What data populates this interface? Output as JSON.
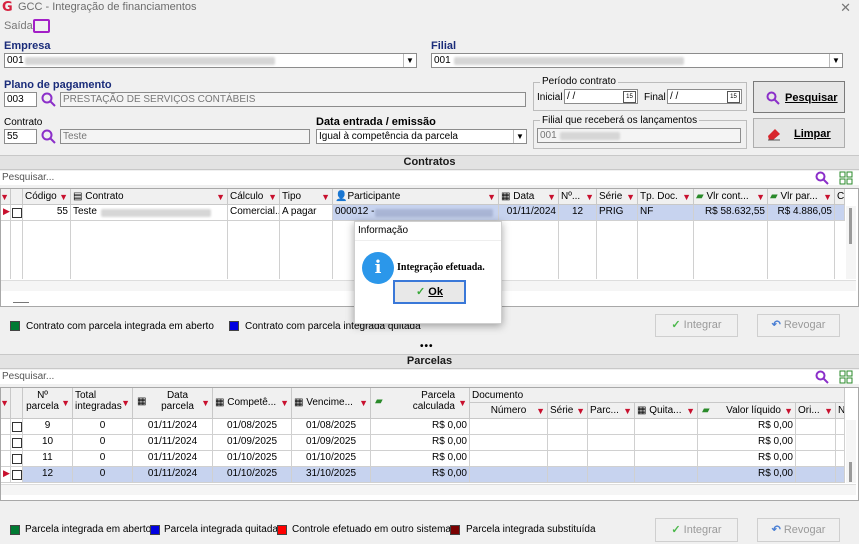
{
  "window": {
    "title": "GCC - Integração de financiamentos",
    "close": "✕",
    "logo": "G"
  },
  "menu": {
    "saida": "Saída"
  },
  "empresa": {
    "label": "Empresa",
    "value": "001"
  },
  "filial": {
    "label": "Filial",
    "value": "001"
  },
  "plano": {
    "label": "Plano de pagamento",
    "code": "003",
    "desc": "PRESTAÇÃO DE SERVIÇOS CONTÁBEIS"
  },
  "periodo": {
    "label": "Período contrato",
    "inicial_label": "Inicial",
    "inicial_value": "/ /",
    "final_label": "Final",
    "final_value": "/ /"
  },
  "contrato": {
    "label": "Contrato",
    "code": "55",
    "desc": "Teste"
  },
  "data_entrada": {
    "label": "Data entrada / emissão",
    "value": "Igual à competência da parcela"
  },
  "filial_lanc": {
    "label": "Filial que receberá os lançamentos",
    "value": "001"
  },
  "buttons": {
    "pesquisar": "Pesquisar",
    "limpar": "Limpar",
    "integrar": "Integrar",
    "revogar": "Revogar"
  },
  "contratos": {
    "section_title": "Contratos",
    "search_placeholder": "Pesquisar...",
    "columns": [
      "Código",
      "Contrato",
      "Cálculo",
      "Tipo",
      "Participante",
      "Data",
      "Nº...",
      "Série",
      "Tp. Doc.",
      "Vlr cont...",
      "Vlr par...",
      "C"
    ],
    "rows": [
      {
        "codigo": "55",
        "contrato": "Teste",
        "calculo": "Comercial...",
        "tipo": "A pagar",
        "participante": "000012 -",
        "data": "01/11/2024",
        "numero": "12",
        "serie": "PRIG",
        "tpdoc": "NF",
        "vlr_cont": "R$ 58.632,55",
        "vlr_par": "R$ 4.886,05"
      }
    ],
    "legend": [
      "Contrato com parcela integrada em aberto",
      "Contrato com parcela integrada quitada"
    ]
  },
  "parcelas": {
    "section_title": "Parcelas",
    "search_placeholder": "Pesquisar...",
    "columns": {
      "numero_parcela": "Nº parcela",
      "total_integradas": "Total integradas",
      "data_parcela": "Data parcela",
      "competencia": "Competê...",
      "vencimento": "Vencime...",
      "parcela_calculada": "Parcela calculada",
      "documento": "Documento",
      "doc_numero": "Número",
      "doc_serie": "Série",
      "doc_parc": "Parc...",
      "doc_quita": "Quita...",
      "valor_liquido": "Valor líquido",
      "ori": "Ori...",
      "n": "N"
    },
    "rows": [
      {
        "num": "9",
        "total": "0",
        "data": "01/11/2024",
        "comp": "01/08/2025",
        "venc": "01/08/2025",
        "calc": "R$ 0,00",
        "liq": "R$ 0,00"
      },
      {
        "num": "10",
        "total": "0",
        "data": "01/11/2024",
        "comp": "01/09/2025",
        "venc": "01/09/2025",
        "calc": "R$ 0,00",
        "liq": "R$ 0,00"
      },
      {
        "num": "11",
        "total": "0",
        "data": "01/11/2024",
        "comp": "01/10/2025",
        "venc": "01/10/2025",
        "calc": "R$ 0,00",
        "liq": "R$ 0,00"
      },
      {
        "num": "12",
        "total": "0",
        "data": "01/11/2024",
        "comp": "01/10/2025",
        "venc": "31/10/2025",
        "calc": "R$ 0,00",
        "liq": "R$ 0,00"
      }
    ],
    "legend": [
      "Parcela integrada em aberto",
      "Parcela integrada quitada",
      "Controle efetuado em outro sistema",
      "Parcela integrada substituída"
    ]
  },
  "dialog": {
    "title": "Informação",
    "message": "Integração efetuada.",
    "ok": "Ok",
    "icon": "i"
  },
  "colors": {
    "accent": "#1a2c7a",
    "green": "#007a33",
    "blue": "#0000e0",
    "red": "#ff0000",
    "darkred": "#7a0000",
    "selected": "#c7d3ef"
  }
}
